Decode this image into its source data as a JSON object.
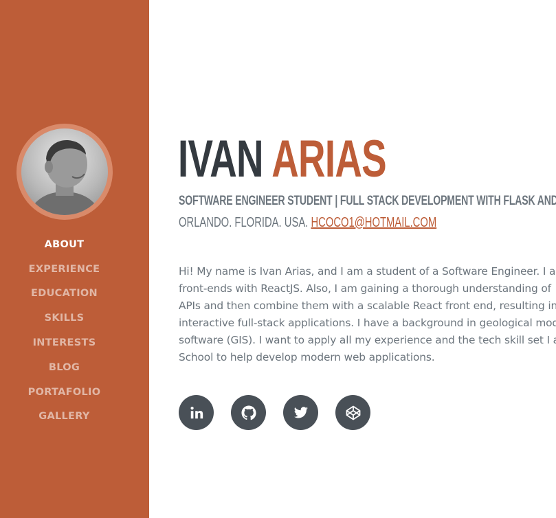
{
  "profile": {
    "first_name": "IVAN",
    "last_name": "ARIAS",
    "subtitle": "SOFTWARE ENGINEER STUDENT | FULL STACK DEVELOPMENT WITH FLASK AND REACT |",
    "location": "ORLANDO. FLORIDA. USA.",
    "email": "HCOCO1@HOTMAIL.COM"
  },
  "nav": {
    "items": [
      {
        "label": "ABOUT",
        "active": true
      },
      {
        "label": "EXPERIENCE",
        "active": false
      },
      {
        "label": "EDUCATION",
        "active": false
      },
      {
        "label": "SKILLS",
        "active": false
      },
      {
        "label": "INTERESTS",
        "active": false
      },
      {
        "label": "BLOG",
        "active": false
      },
      {
        "label": "PORTAFOLIO",
        "active": false
      },
      {
        "label": "GALLERY",
        "active": false
      }
    ]
  },
  "bio": {
    "lines": [
      "Hi! My name is Ivan Arias, and I am a student of a Software Engineer. I a",
      "front-ends with ReactJS. Also, I am gaining a thorough understanding of",
      "APIs and then combine them with a scalable React front end, resulting in",
      "interactive full-stack applications. I have a background in geological mod",
      "software (GIS). I want to apply all my experience and the tech skill set I a",
      "School to help develop modern web applications."
    ]
  },
  "social": {
    "icons": [
      "linkedin-icon",
      "github-icon",
      "twitter-icon",
      "codepen-icon"
    ]
  },
  "colors": {
    "primary": "#bd5d38",
    "dark": "#343a40",
    "muted": "#6c757d",
    "social_bg": "#495057"
  }
}
